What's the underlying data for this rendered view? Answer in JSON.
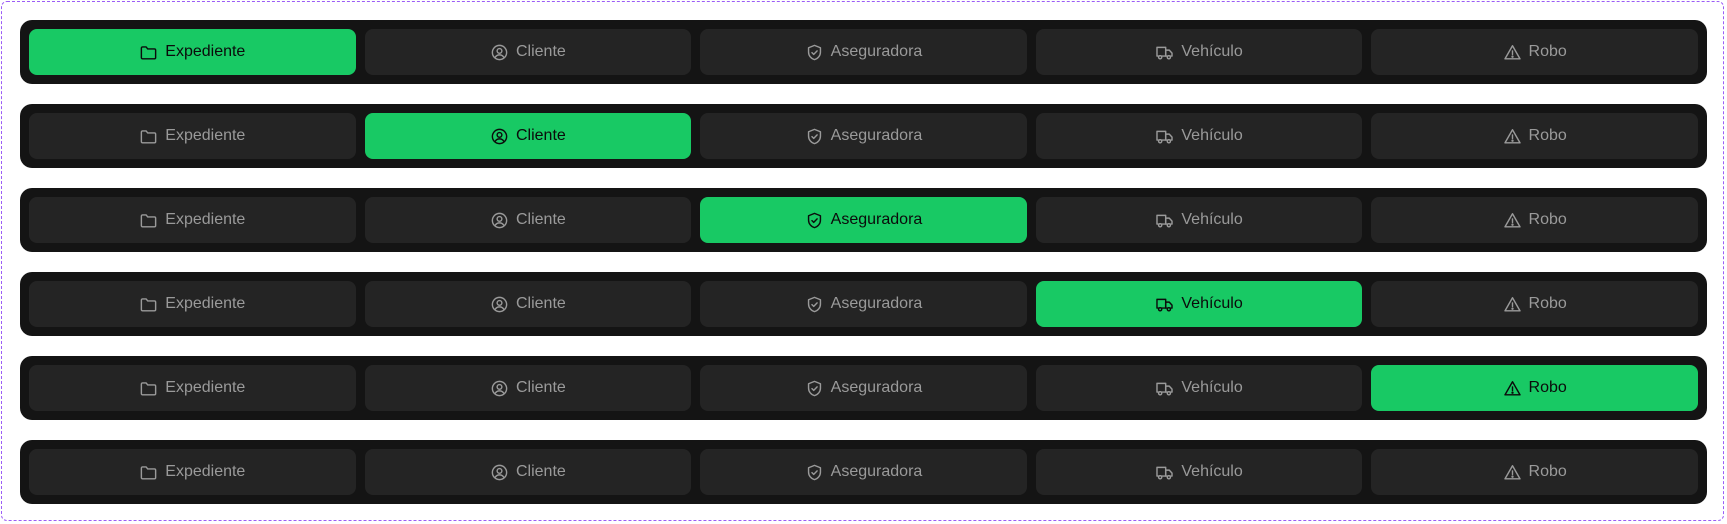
{
  "colors": {
    "bar_bg": "#141414",
    "tab_bg": "#242424",
    "tab_text": "#9a9a9a",
    "active_bg": "#18c964",
    "active_text": "#0b0b0b"
  },
  "tabs": [
    {
      "id": "expediente",
      "label": "Expediente",
      "icon": "folder-icon"
    },
    {
      "id": "cliente",
      "label": "Cliente",
      "icon": "user-circle-icon"
    },
    {
      "id": "aseguradora",
      "label": "Aseguradora",
      "icon": "shield-check-icon"
    },
    {
      "id": "vehiculo",
      "label": "Vehículo",
      "icon": "truck-icon"
    },
    {
      "id": "robo",
      "label": "Robo",
      "icon": "warning-triangle-icon"
    }
  ],
  "variants": [
    {
      "active": "expediente"
    },
    {
      "active": "cliente"
    },
    {
      "active": "aseguradora"
    },
    {
      "active": "vehiculo"
    },
    {
      "active": "robo"
    },
    {
      "active": null
    }
  ]
}
